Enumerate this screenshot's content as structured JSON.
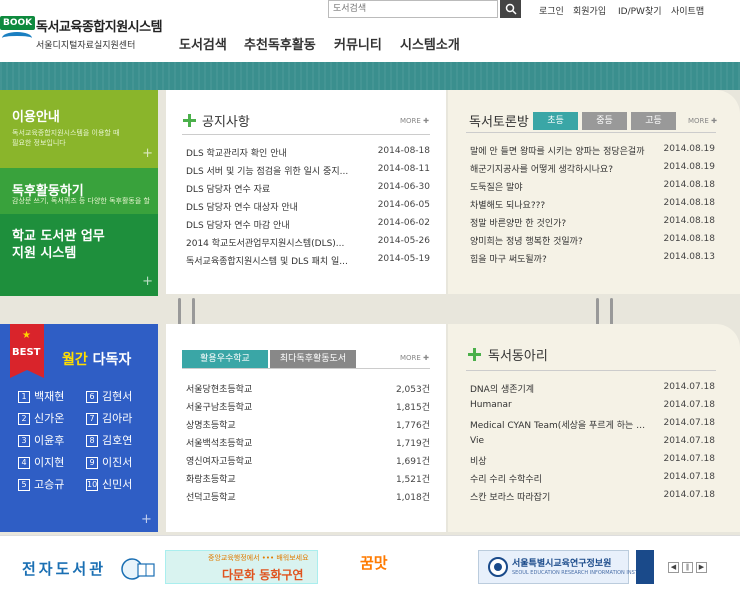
{
  "header": {
    "logo_book": "BOOK",
    "logo_title": "독서교육종합지원시스템",
    "logo_sub": "서울디지털자료실지원센터",
    "search_placeholder": "도서검색",
    "util": [
      "로그인",
      "회원가입",
      "ID/PW찾기",
      "사이트맵"
    ],
    "gnb": [
      "도서검색",
      "추천독후활동",
      "커뮤니티",
      "시스템소개"
    ]
  },
  "left_menu": [
    {
      "title": "이용안내",
      "desc": "독서교육종합지원시스템을 이용할 때 필요한 정보입니다"
    },
    {
      "title": "독후활동하기",
      "desc": "감상문 쓰기, 독서퀴즈 등 다양한 독후활동을 할 수 있습니다."
    },
    {
      "title": "학교 도서관 업무지원 시스템",
      "desc": ""
    }
  ],
  "notice": {
    "title": "공지사항",
    "more": "MORE",
    "items": [
      {
        "t": "DLS 학교관리자 확인 안내",
        "d": "2014-08-18"
      },
      {
        "t": "DLS 서버 및 기능 점검을 위한 일시 중지...",
        "d": "2014-08-11"
      },
      {
        "t": "DLS 담당자 연수 자료",
        "d": "2014-06-30"
      },
      {
        "t": "DLS 담당자 연수 대상자 안내",
        "d": "2014-06-05"
      },
      {
        "t": "DLS 담당자 연수 마감 안내",
        "d": "2014-06-02"
      },
      {
        "t": "2014 학교도서관업무지원시스템(DLS)...",
        "d": "2014-05-26"
      },
      {
        "t": "독서교육종합지원시스템 및 DLS 패치 일...",
        "d": "2014-05-19"
      }
    ]
  },
  "debate": {
    "title": "독서토론방",
    "tabs": [
      "초등",
      "중등",
      "고등"
    ],
    "more": "MORE",
    "items": [
      {
        "t": "말에 안 들면 왕따를 시키는 양파는 정당은걸까",
        "d": "2014.08.19"
      },
      {
        "t": "해군기지공사를 어떻게 생각하시나요?",
        "d": "2014.08.19"
      },
      {
        "t": "도둑질은 말야",
        "d": "2014.08.18"
      },
      {
        "t": "차별해도 되나요???",
        "d": "2014.08.18"
      },
      {
        "t": "정말 바른양만 한 것인가?",
        "d": "2014.08.18"
      },
      {
        "t": "양미희는 정녕 행복한 것일까?",
        "d": "2014.08.18"
      },
      {
        "t": "힘을 마구 써도될까?",
        "d": "2014.08.13"
      }
    ]
  },
  "best": {
    "badge": "BEST",
    "title_hl": "월간",
    "title": "다독자",
    "ranks": [
      "백재현",
      "김현서",
      "신가온",
      "김아라",
      "이윤후",
      "김호연",
      "이지현",
      "이진서",
      "고승규",
      "신민서"
    ]
  },
  "schools": {
    "tabs": [
      "활용우수학교",
      "최다독후활동도서"
    ],
    "more": "MORE",
    "items": [
      {
        "t": "서울당현초등학교",
        "d": "2,053건"
      },
      {
        "t": "서울구남초등학교",
        "d": "1,815건"
      },
      {
        "t": "상명초등학교",
        "d": "1,776건"
      },
      {
        "t": "서울백석초등학교",
        "d": "1,719건"
      },
      {
        "t": "영신여자고등학교",
        "d": "1,691건"
      },
      {
        "t": "화랑초등학교",
        "d": "1,521건"
      },
      {
        "t": "선덕고등학교",
        "d": "1,018건"
      }
    ]
  },
  "clubs": {
    "title": "독서동아리",
    "items": [
      {
        "t": "DNA의 생존기계",
        "d": "2014.07.18"
      },
      {
        "t": "Humanar",
        "d": "2014.07.18"
      },
      {
        "t": "Medical CYAN Team(세상을 푸르게 하는 의료팀)",
        "d": "2014.07.18"
      },
      {
        "t": "Vie",
        "d": "2014.07.18"
      },
      {
        "t": "비상",
        "d": "2014.07.18"
      },
      {
        "t": "수리 수리 수학수리",
        "d": "2014.07.18"
      },
      {
        "t": "스칸 보라스 따라잡기",
        "d": "2014.07.18"
      }
    ]
  },
  "footer": {
    "edoc": "전자도서관",
    "banner1_small": "중앙교육행정에서 ••• 배워보세요",
    "banner1_big": "다문화 동화구연",
    "banner2": "꿈맛",
    "banner3_title": "서울특별시교육연구정보원",
    "banner3_sub": "SEOUL EDUCATION RESEARCH INFORMATION INSTITUTE",
    "controls": [
      "◀",
      "∥",
      "▶"
    ]
  },
  "colors": {
    "teal": "#3a8f8e",
    "green": "#4bb04b",
    "blue": "#2f5ec5",
    "red": "#d9242b"
  }
}
